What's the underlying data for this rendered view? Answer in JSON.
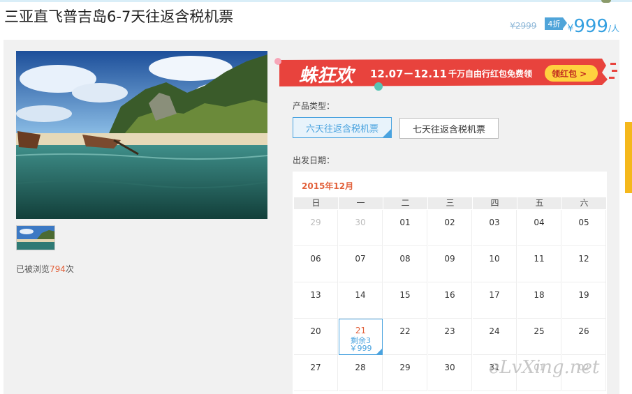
{
  "header": {
    "title": "三亚直飞普吉岛6-7天往返含税机票",
    "old_price": "¥2999",
    "discount": "4折",
    "currency": "¥",
    "price": "999",
    "unit": "/人"
  },
  "gallery": {
    "views_prefix": "已被浏览",
    "views_count": "794",
    "views_suffix": "次"
  },
  "banner": {
    "brand_text": "蛛狂欢",
    "dates": "12.07－12.11",
    "promo": "千万自由行红包免费领",
    "button": "领红包 >"
  },
  "product": {
    "type_label": "产品类型：",
    "options": [
      "六天往返含税机票",
      "七天往返含税机票"
    ],
    "date_label": "出发日期："
  },
  "calendar": {
    "month": "2015年12月",
    "weekdays": [
      "日",
      "一",
      "二",
      "三",
      "四",
      "五",
      "六"
    ],
    "rows": [
      [
        "29",
        "30",
        "01",
        "02",
        "03",
        "04",
        "05"
      ],
      [
        "06",
        "07",
        "08",
        "09",
        "10",
        "11",
        "12"
      ],
      [
        "13",
        "14",
        "15",
        "16",
        "17",
        "18",
        "19"
      ],
      [
        "20",
        "21",
        "22",
        "23",
        "24",
        "25",
        "26"
      ],
      [
        "27",
        "28",
        "29",
        "30",
        "31",
        "01",
        "02"
      ]
    ],
    "selected_remaining": "剩余3",
    "selected_price": "￥999"
  },
  "watermark": "eLvXing.net",
  "colors": {
    "accent": "#4aa3df",
    "highlight": "#e2613b",
    "banner": "#e8433d"
  }
}
